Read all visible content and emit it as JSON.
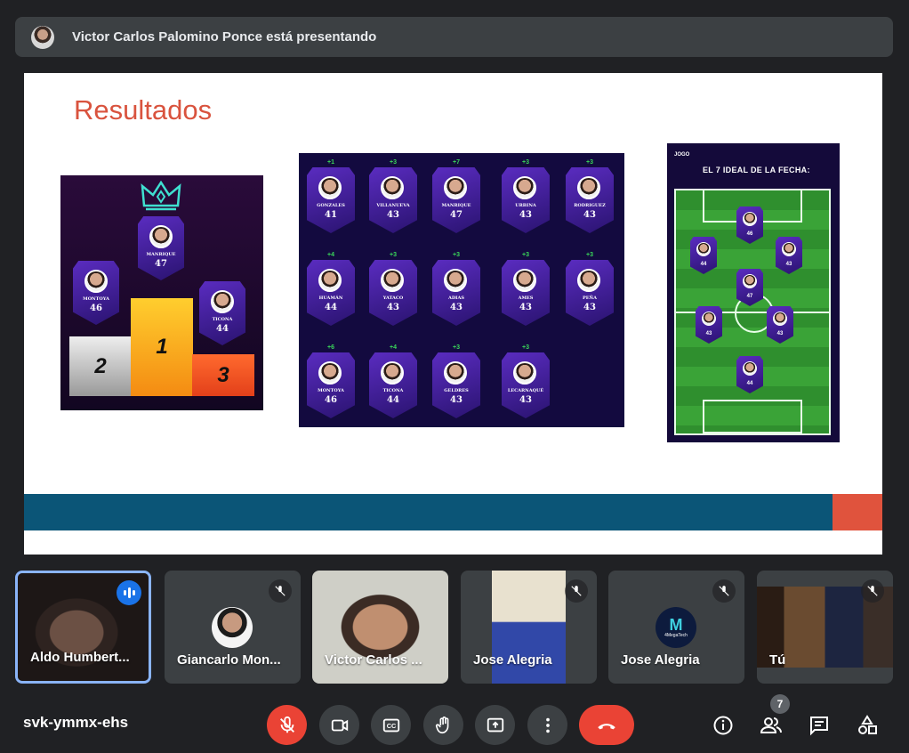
{
  "presenter": {
    "text": "Victor Carlos Palomino Ponce está presentando"
  },
  "slide": {
    "title": "Resultados",
    "podium": {
      "first": {
        "name": "MANRIQUE",
        "score": "47",
        "place": "1"
      },
      "second": {
        "name": "MONTOYA",
        "score": "46",
        "place": "2"
      },
      "third": {
        "name": "TICONA",
        "score": "44",
        "place": "3"
      }
    },
    "grid": [
      {
        "delta": "+1",
        "name": "GONZALES",
        "score": "41"
      },
      {
        "delta": "+3",
        "name": "VILLANUEVA",
        "score": "43"
      },
      {
        "delta": "+7",
        "name": "MANRIQUE",
        "score": "47"
      },
      {
        "delta": "+3",
        "name": "URBINA",
        "score": "43"
      },
      {
        "delta": "+3",
        "name": "RODRIGUEZ",
        "score": "43"
      },
      {
        "delta": "+4",
        "name": "HUAMÁN",
        "score": "44"
      },
      {
        "delta": "+3",
        "name": "YATACO",
        "score": "43"
      },
      {
        "delta": "+3",
        "name": "ADIAS",
        "score": "43"
      },
      {
        "delta": "+3",
        "name": "AMES",
        "score": "43"
      },
      {
        "delta": "+3",
        "name": "PEÑA",
        "score": "43"
      },
      {
        "delta": "+6",
        "name": "MONTOYA",
        "score": "46"
      },
      {
        "delta": "+4",
        "name": "TICONA",
        "score": "44"
      },
      {
        "delta": "+3",
        "name": "GELDRES",
        "score": "43"
      },
      {
        "delta": "+3",
        "name": "LECARNAQUÉ",
        "score": "43"
      }
    ],
    "ideal": {
      "logo": "JOGO",
      "title": "EL 7 IDEAL DE LA FECHA:",
      "players": [
        "46",
        "44",
        "43",
        "47",
        "43",
        "43",
        "44"
      ]
    }
  },
  "participants": [
    {
      "name": "Aldo Humbert...",
      "speaking": true
    },
    {
      "name": "Giancarlo Mon...",
      "muted": true
    },
    {
      "name": "Victor Carlos ..."
    },
    {
      "name": "Jose Alegria",
      "muted": true
    },
    {
      "name": "Jose Alegria",
      "muted": true,
      "avatar_text": "4MegaTech"
    },
    {
      "name": "Tú",
      "muted": true
    }
  ],
  "meeting": {
    "code": "svk-ymmx-ehs",
    "people_count": "7"
  },
  "colors": {
    "hangup": "#ea4335",
    "accent": "#8ab4f8",
    "title_red": "#d9533e",
    "band_blue": "#0b5577"
  },
  "icons": [
    "mic-off-icon",
    "camera-icon",
    "captions-icon",
    "raise-hand-icon",
    "present-icon",
    "more-icon",
    "hangup-icon",
    "info-icon",
    "people-icon",
    "chat-icon",
    "activities-icon"
  ]
}
